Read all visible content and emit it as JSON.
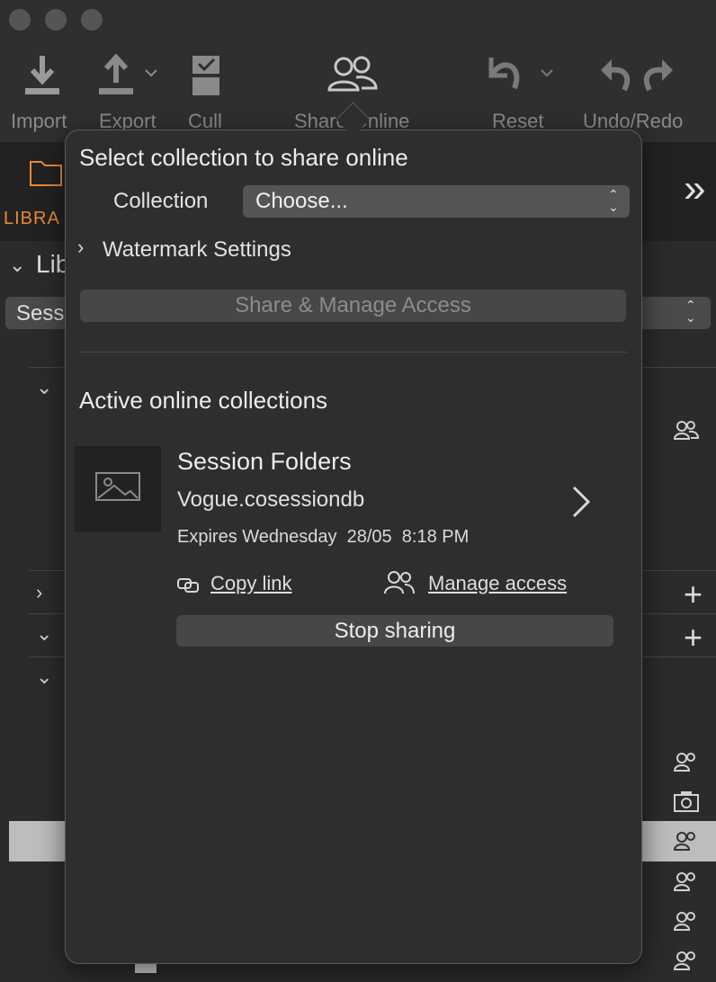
{
  "toolbar": {
    "items": [
      {
        "label": "Import",
        "icon": "download-icon"
      },
      {
        "label": "Export",
        "icon": "upload-icon"
      },
      {
        "label": "Cull",
        "icon": "cull-icon"
      },
      {
        "label": "Share Online",
        "icon": "people-icon"
      },
      {
        "label": "Reset",
        "icon": "reset-icon"
      },
      {
        "label": "Undo/Redo",
        "icon": "undo-redo-icon"
      }
    ]
  },
  "sidebar": {
    "tab_label": "LIBRA",
    "section_label": "Lib",
    "session_select": "Sess"
  },
  "popover": {
    "title": "Select collection to share online",
    "collection_label": "Collection",
    "collection_value": "Choose...",
    "watermark_label": "Watermark Settings",
    "share_button": "Share & Manage Access",
    "active_title": "Active online collections",
    "collection": {
      "name": "Session Folders",
      "db": "Vogue.cosessiondb",
      "expires": "Expires Wednesday  28/05  8:18 PM",
      "copy_link": "Copy link",
      "manage_access": "Manage access",
      "stop_sharing": "Stop sharing"
    }
  },
  "colors": {
    "background": "#2b2b2b",
    "popover": "#2e2e2e",
    "accent": "#e8893a"
  }
}
